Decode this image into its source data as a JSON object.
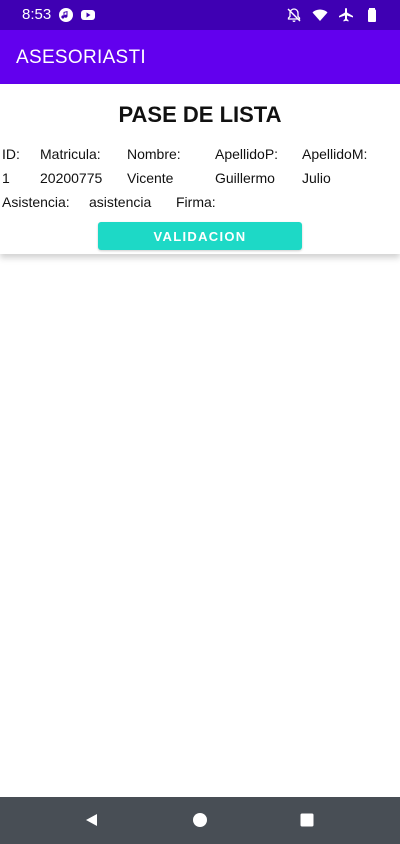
{
  "status_bar": {
    "time": "8:53",
    "left_icons": [
      "music-icon",
      "youtube-icon"
    ],
    "right_icons": [
      "notifications-off-icon",
      "wifi-icon",
      "airplane-icon",
      "battery-icon"
    ]
  },
  "app_bar": {
    "title": "ASESORIASTI"
  },
  "card": {
    "title": "PASE DE LISTA",
    "headers": {
      "id": "ID:",
      "matricula": "Matricula:",
      "nombre": "Nombre:",
      "apellido_p": "ApellidoP:",
      "apellido_m": "ApellidoM:"
    },
    "row": {
      "id": "1",
      "matricula": "20200775",
      "nombre": "Vicente",
      "apellido_p": "Guillermo",
      "apellido_m": "Julio"
    },
    "asistencia_label": "Asistencia:",
    "asistencia_value": "asistencia",
    "firma_label": "Firma:",
    "validate_label": "VALIDACION"
  },
  "nav_bar": {
    "buttons": [
      "back-icon",
      "home-icon",
      "recents-icon"
    ]
  },
  "colors": {
    "status_bar": "#3f00b3",
    "app_bar": "#6200ee",
    "button": "#1dd9c6",
    "nav_bar": "#484e55"
  }
}
